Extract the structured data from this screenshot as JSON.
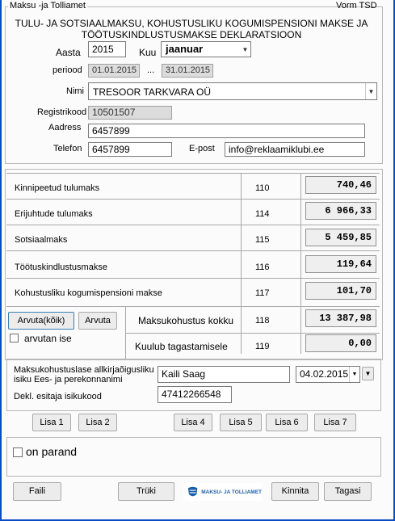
{
  "form": {
    "group_title": "Maksu -ja Tolliamet",
    "form_code": "Vorm TSD",
    "header_line1": "TULU- JA SOTSIAALMAKSU, KOHUSTUSLIKU KOGUMISPENSIONI MAKSE JA",
    "header_line2": "TÖÖTUSKINDLUSTUSMAKSE DEKLARATSIOON"
  },
  "period": {
    "year_label": "Aasta",
    "year_value": "2015",
    "month_label": "Kuu",
    "month_value": "jaanuar",
    "period_label": "periood",
    "from": "01.01.2015",
    "sep": "...",
    "to": "31.01.2015"
  },
  "company": {
    "name_label": "Nimi",
    "name_value": "TRESOOR TARKVARA OÜ",
    "regcode_label": "Registrikood",
    "regcode_value": "10501507",
    "address_label": "Aadress",
    "address_value": "6457899",
    "phone_label": "Telefon",
    "phone_value": "6457899",
    "email_label": "E-post",
    "email_value": "info@reklaamiklubi.ee"
  },
  "taxes": [
    {
      "name": "Kinnipeetud tulumaks",
      "code": "110",
      "value": "740,46"
    },
    {
      "name": "Erijuhtude tulumaks",
      "code": "114",
      "value": "6 966,33"
    },
    {
      "name": "Sotsiaalmaks",
      "code": "115",
      "value": "5 459,85"
    },
    {
      "name": "Töötuskindlustusmakse",
      "code": "116",
      "value": "119,64"
    },
    {
      "name": "Kohustusliku kogumispensioni makse",
      "code": "117",
      "value": "101,70"
    }
  ],
  "totals": {
    "calc_all_label": "Arvuta(kõik)",
    "calc_label": "Arvuta",
    "calc_self_label": "arvutan ise",
    "total_name": "Maksukohustus kokku",
    "total_code": "118",
    "total_value": "13 387,98",
    "refund_name": "Kuulub tagastamisele",
    "refund_code": "119",
    "refund_value": "0,00"
  },
  "signer": {
    "label_line1": "Maksukohustuslase allkirjaõigusliku",
    "label_line2": "isiku Ees- ja perekonnanimi",
    "name_value": "Kaili Saag",
    "date_value": "04.02.2015",
    "id_label": "Dekl. esitaja isikukood",
    "id_value": "47412266548"
  },
  "attachments": [
    "Lisa 1",
    "Lisa 2",
    "Lisa 4",
    "Lisa 5",
    "Lisa 6",
    "Lisa 7"
  ],
  "amend": {
    "label": "on parand"
  },
  "footer": {
    "file": "Faili",
    "print": "Trüki",
    "logo_text": "MAKSU- JA TOLLIAMET",
    "confirm": "Kinnita",
    "back": "Tagasi"
  }
}
